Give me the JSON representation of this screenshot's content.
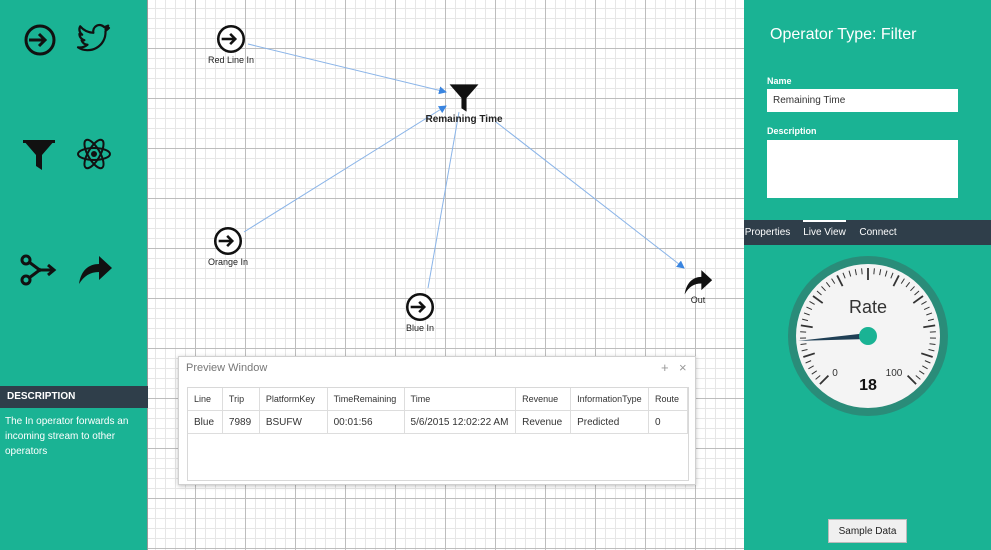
{
  "left_panel": {
    "tools": [
      {
        "icon": "input-icon"
      },
      {
        "icon": "twitter-icon"
      },
      {
        "icon": "filter-icon"
      },
      {
        "icon": "atom-icon"
      },
      {
        "icon": "split-icon"
      },
      {
        "icon": "output-arrow-icon"
      }
    ],
    "description_header": "DESCRIPTION",
    "description_text": "The In operator forwards an incoming stream to other operators"
  },
  "canvas": {
    "nodes": {
      "red_line_in": "Red Line In",
      "remaining_time": "Remaining Time",
      "orange_in": "Orange In",
      "blue_in": "Blue In",
      "out": "Out"
    },
    "wire_color": "#8ab4e8"
  },
  "preview": {
    "title": "Preview Window",
    "add_symbol": "+",
    "close_symbol": "×",
    "columns": [
      "Line",
      "Trip",
      "PlatformKey",
      "TimeRemaining",
      "Time",
      "Revenue",
      "InformationType",
      "Route"
    ],
    "rows": [
      [
        "Blue",
        "7989",
        "BSUFW",
        "00:01:56",
        "5/6/2015 12:02:22 AM",
        "Revenue",
        "Predicted",
        "0"
      ]
    ]
  },
  "right_panel": {
    "title": "Operator Type: Filter",
    "name_label": "Name",
    "name_value": "Remaining Time",
    "description_label": "Description",
    "description_value": "",
    "tabs": [
      "Properties",
      "Live View",
      "Connect"
    ],
    "active_tab": "Live View",
    "gauge": {
      "label": "Rate",
      "value": 18,
      "min_label": "0",
      "max_label": "100"
    },
    "sample_button": "Sample Data"
  },
  "colors": {
    "accent": "#1ab394",
    "dark": "#2f3e4a"
  }
}
